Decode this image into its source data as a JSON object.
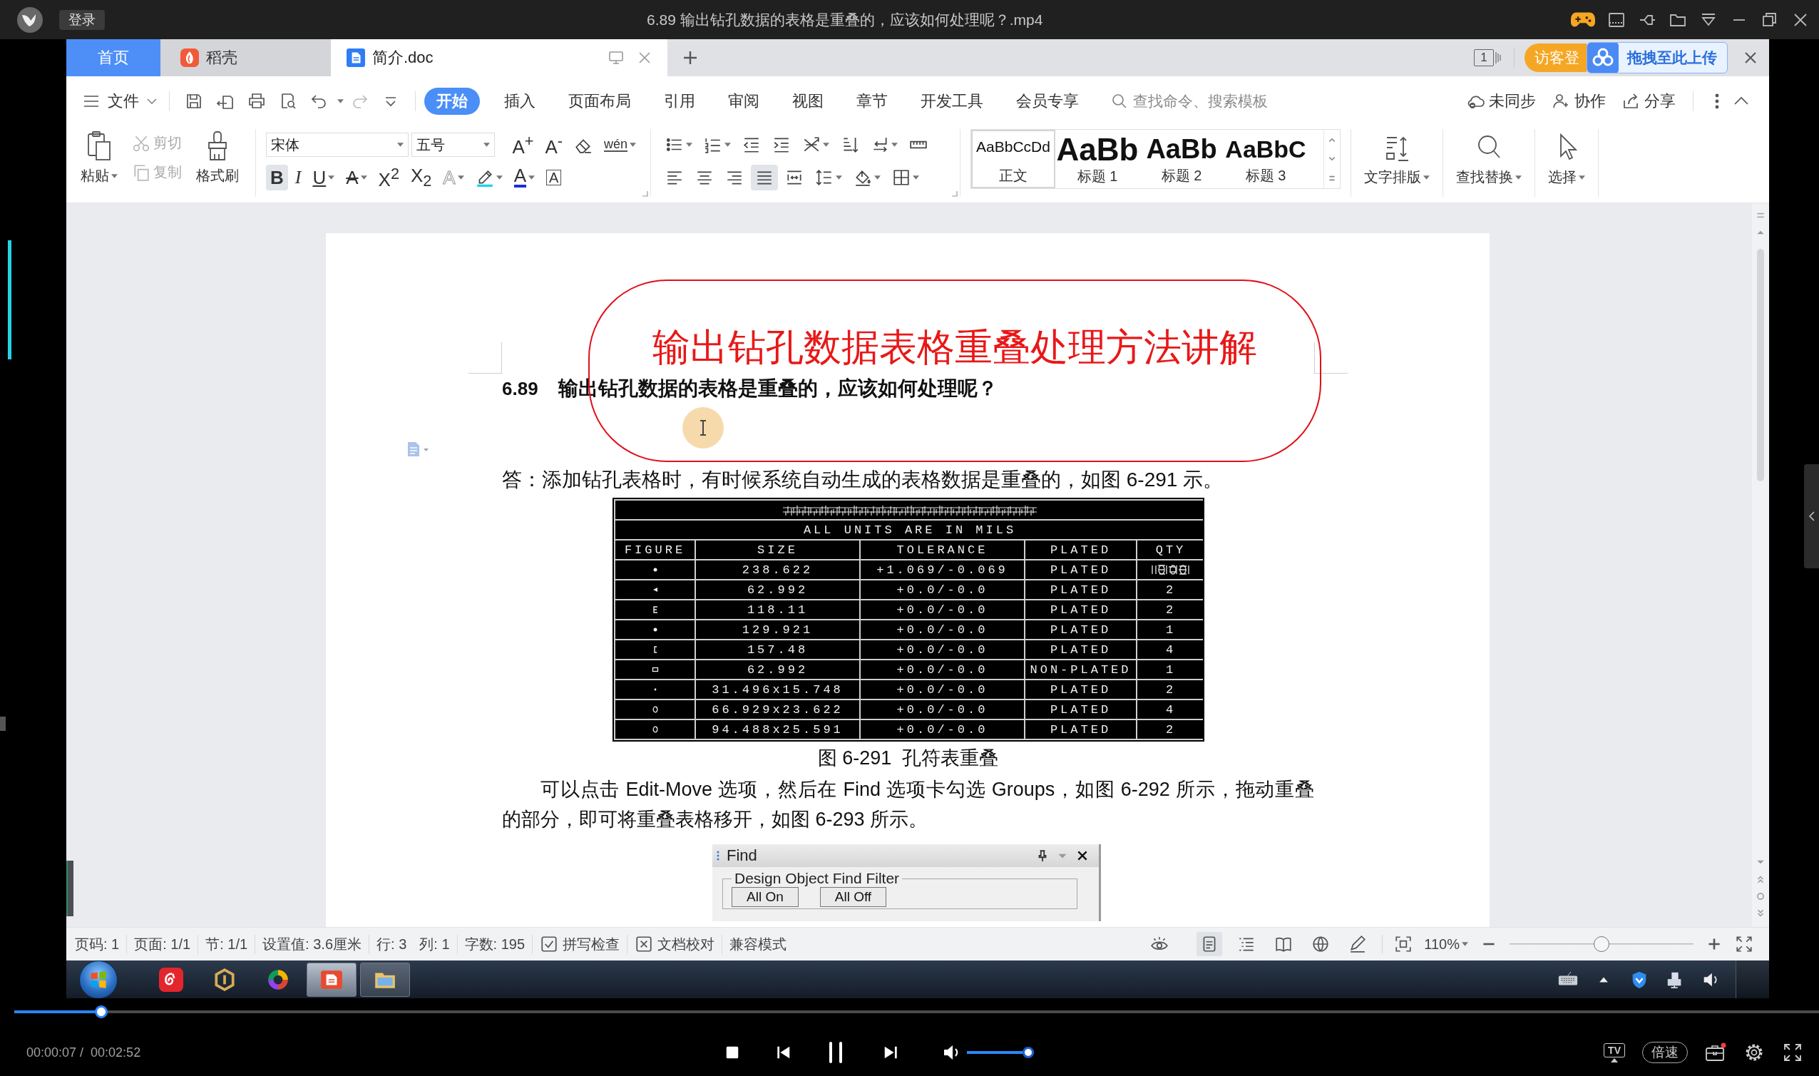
{
  "player": {
    "login": "登录",
    "title": "6.89 输出钻孔数据的表格是重叠的，应该如何处理呢？.mp4",
    "progress": {
      "level": 0.045
    },
    "time": "00:00:07 /  00:02:52",
    "volume": {
      "level": 1
    },
    "cast": "TV",
    "speed": "倍速"
  },
  "tabs": [
    {
      "label": "首页",
      "kind": "home",
      "selected": false
    },
    {
      "label": "稻壳",
      "kind": "docer",
      "selected": false
    },
    {
      "label": "简介.doc",
      "kind": "document",
      "selected": true
    }
  ],
  "account": {
    "window_count": "1",
    "guest_login": "访客登",
    "upload": "拖拽至此上传"
  },
  "menu": {
    "file": "文件",
    "tabs": [
      {
        "label": "开始",
        "selected": true
      },
      {
        "label": "插入",
        "selected": false
      },
      {
        "label": "页面布局",
        "selected": false
      },
      {
        "label": "引用",
        "selected": false
      },
      {
        "label": "审阅",
        "selected": false
      },
      {
        "label": "视图",
        "selected": false
      },
      {
        "label": "章节",
        "selected": false
      },
      {
        "label": "开发工具",
        "selected": false
      },
      {
        "label": "会员专享",
        "selected": false
      }
    ],
    "search": {
      "placeholder": "查找命令、搜索模板"
    },
    "actions": [
      {
        "label": "未同步",
        "kind": "sync"
      },
      {
        "label": "协作",
        "kind": "collaborate"
      },
      {
        "label": "分享",
        "kind": "share"
      }
    ]
  },
  "ribbon": {
    "clipboard": {
      "paste": "粘贴",
      "cut": {
        "label": "剪切",
        "disabled": true
      },
      "copy": {
        "label": "复制",
        "disabled": true
      },
      "format_painter": "格式刷"
    },
    "font": {
      "name": "宋体",
      "size": "五号",
      "tools": [
        {
          "kind": "grow",
          "glyph": "A$^{+}$",
          "dropdown": false
        },
        {
          "kind": "shrink",
          "glyph": "A$^{-}$",
          "dropdown": false
        },
        {
          "kind": "clear",
          "dropdown": false
        },
        {
          "kind": "pinyin",
          "glyph": "wén",
          "dropdown": true
        }
      ],
      "buttons": [
        {
          "kind": "bold",
          "glyph": "B",
          "selected": true,
          "dropdown": false
        },
        {
          "kind": "italic",
          "glyph": "I",
          "selected": false,
          "dropdown": false
        },
        {
          "kind": "underline",
          "glyph": "U",
          "selected": false,
          "dropdown": true
        },
        {
          "kind": "strike",
          "glyph": "A",
          "selected": false,
          "dropdown": true
        },
        {
          "kind": "superscript",
          "glyph": "X$^{2}$",
          "selected": false,
          "dropdown": false
        },
        {
          "kind": "subscript",
          "glyph": "X$_{2}$",
          "selected": false,
          "dropdown": false
        },
        {
          "kind": "effect",
          "glyph": "A",
          "selected": false,
          "dropdown": true
        },
        {
          "kind": "highlight",
          "selected": false,
          "dropdown": true
        },
        {
          "kind": "color",
          "glyph": "A",
          "selected": false,
          "dropdown": true
        },
        {
          "kind": "border",
          "glyph": "A",
          "selected": false,
          "dropdown": false
        }
      ]
    },
    "paragraph": {
      "rows": [
        [
          {
            "kind": "bullets",
            "dropdown": true,
            "selected": false
          },
          {
            "kind": "numbering",
            "dropdown": true,
            "selected": false
          },
          {
            "kind": "outdent",
            "dropdown": false,
            "selected": false
          },
          {
            "kind": "indent",
            "dropdown": false,
            "selected": false
          },
          {
            "kind": "layout",
            "dropdown": true,
            "selected": false
          },
          {
            "kind": "sort",
            "dropdown": false,
            "selected": false
          },
          {
            "kind": "marks",
            "dropdown": true,
            "selected": false
          },
          {
            "kind": "tabs",
            "dropdown": false,
            "selected": false
          }
        ],
        [
          {
            "kind": "left",
            "dropdown": false,
            "selected": false
          },
          {
            "kind": "center",
            "dropdown": false,
            "selected": false
          },
          {
            "kind": "right",
            "dropdown": false,
            "selected": false
          },
          {
            "kind": "justify",
            "dropdown": false,
            "selected": true
          },
          {
            "kind": "distribute",
            "dropdown": false,
            "selected": false
          },
          {
            "kind": "spacing",
            "dropdown": true,
            "selected": false
          },
          {
            "kind": "shading",
            "dropdown": true,
            "selected": false
          },
          {
            "kind": "borders",
            "dropdown": true,
            "selected": false
          }
        ]
      ]
    },
    "styles": [
      {
        "kind": "body",
        "sample": "AaBbCcDd",
        "label": "正文",
        "selected": true
      },
      {
        "kind": "h1",
        "sample": "AaBb",
        "label": "标题 1",
        "selected": false
      },
      {
        "kind": "h2",
        "sample": "AaBb",
        "label": "标题 2",
        "selected": false
      },
      {
        "kind": "h3",
        "sample": "AaBbC",
        "label": "标题 3",
        "selected": false
      }
    ],
    "tools": [
      {
        "kind": "layout",
        "label": "文字排版"
      },
      {
        "kind": "find",
        "label": "查找替换"
      },
      {
        "kind": "select",
        "label": "选择"
      }
    ]
  },
  "document": {
    "heading_number": "6.89",
    "heading": "输出钻孔数据的表格是重叠的，应该如何处理呢？",
    "overlay_caption": "输出钻孔数据表格重叠处理方法讲解",
    "answer": "答：添加钻孔表格时，有时候系统自动生成的表格数据是重叠的，如图 6-291 示。",
    "drill_table": {
      "units": "ALL UNITS ARE IN MILS",
      "columns": [
        "FIGURE",
        "SIZE",
        "TOLERANCE",
        "PLATED",
        "QTY"
      ],
      "rows": [
        {
          "size": "238.622",
          "tolerance": "+1.069/-0.069",
          "plated": "PLATED"
        },
        {
          "size": "62.992",
          "tolerance": "+0.0/-0.0",
          "plated": "PLATED",
          "qty": "2"
        },
        {
          "size": "118.11",
          "tolerance": "+0.0/-0.0",
          "plated": "PLATED",
          "qty": "2"
        },
        {
          "size": "129.921",
          "tolerance": "+0.0/-0.0",
          "plated": "PLATED",
          "qty": "1"
        },
        {
          "size": "157.48",
          "tolerance": "+0.0/-0.0",
          "plated": "PLATED",
          "qty": "4"
        },
        {
          "size": "62.992",
          "tolerance": "+0.0/-0.0",
          "plated": "NON-PLATED",
          "qty": "1"
        },
        {
          "size": "31.496x15.748",
          "tolerance": "+0.0/-0.0",
          "plated": "PLATED",
          "qty": "2"
        },
        {
          "size": "66.929x23.622",
          "tolerance": "+0.0/-0.0",
          "plated": "PLATED",
          "qty": "4"
        },
        {
          "size": "94.488x25.591",
          "tolerance": "+0.0/-0.0",
          "plated": "PLATED",
          "qty": "2"
        }
      ]
    },
    "caption": "图 6-291  孔符表重叠",
    "paragraph_lines": [
      "可以点击 Edit-Move 选项，然后在 Find 选项卡勾选 Groups，如图 6-292 所示，拖动重叠",
      "的部分，即可将重叠表格移开，如图 6-293 所示。"
    ],
    "find_panel": {
      "title": "Find",
      "group": "Design Object Find Filter",
      "buttons": [
        "All On",
        "All Off"
      ]
    }
  },
  "status": {
    "fields": [
      [
        "页码: 1"
      ],
      [
        "页面: 1/1"
      ],
      [
        "节: 1/1"
      ],
      [
        "设置值: 3.6厘米"
      ],
      [
        "行: 3",
        "列: 1"
      ],
      [
        "字数: 195"
      ]
    ],
    "checks": [
      {
        "kind": "spell",
        "label": "拼写检查"
      },
      {
        "kind": "proof",
        "label": "文档校对"
      }
    ],
    "mode": "兼容模式",
    "views": [
      {
        "kind": "protect",
        "selected": false
      },
      {
        "kind": "page",
        "selected": true
      },
      {
        "kind": "outline",
        "selected": false
      },
      {
        "kind": "reading",
        "selected": false
      },
      {
        "kind": "web",
        "selected": false
      },
      {
        "kind": "write",
        "selected": false
      }
    ],
    "zoom": "110%",
    "zoom_slider": {
      "level": 0.5
    }
  },
  "taskbar": {
    "apps": [
      {
        "kind": "music",
        "running": false,
        "selected": false
      },
      {
        "kind": "reader",
        "running": false,
        "selected": false
      },
      {
        "kind": "browser",
        "running": false,
        "selected": false
      },
      {
        "kind": "writer",
        "running": true,
        "selected": true
      },
      {
        "kind": "files",
        "running": true,
        "selected": false
      }
    ]
  }
}
